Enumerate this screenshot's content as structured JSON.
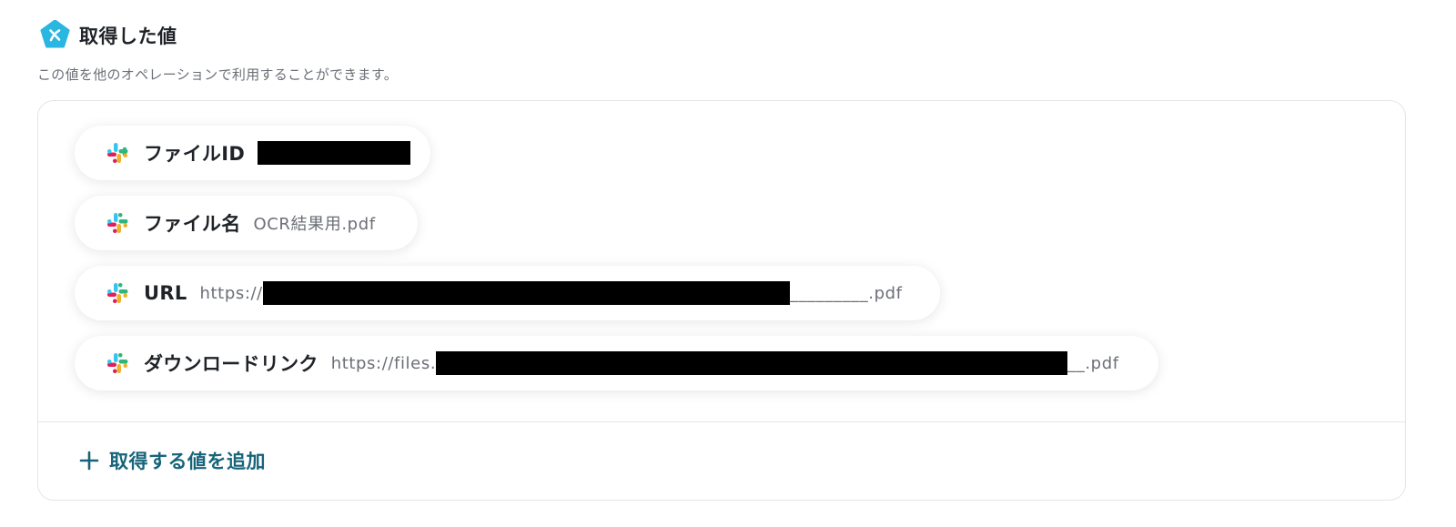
{
  "header": {
    "title": "取得した値",
    "icon": "yoom-logo-icon",
    "icon_color": "#29B6E0"
  },
  "description": "この値を他のオペレーションで利用することができます。",
  "values": [
    {
      "label": "ファイルID",
      "prefix": "",
      "suffix": "",
      "redacted": true,
      "icon": "slack-icon"
    },
    {
      "label": "ファイル名",
      "prefix": "OCR結果用.pdf",
      "suffix": "",
      "redacted": false,
      "icon": "slack-icon"
    },
    {
      "label": "URL",
      "prefix": "https://",
      "suffix": "_________.pdf",
      "redacted": true,
      "icon": "slack-icon"
    },
    {
      "label": "ダウンロードリンク",
      "prefix": "https://files.",
      "suffix": "__.pdf",
      "redacted": true,
      "icon": "slack-icon"
    }
  ],
  "add_button": {
    "label": "取得する値を追加",
    "icon": "plus-icon",
    "color": "#17647A"
  },
  "colors": {
    "border": "#E3E5E8",
    "muted_text": "#6B6F76",
    "slack": [
      "#36C5F0",
      "#2EB67D",
      "#ECB22E",
      "#E01E5A"
    ]
  }
}
